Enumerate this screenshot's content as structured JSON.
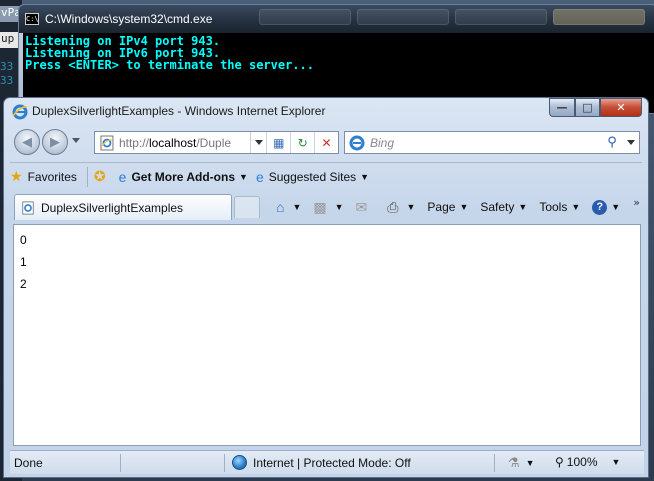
{
  "background_window": {
    "tab1": "vPa",
    "tab2": "up",
    "line_no_1": "33",
    "line_no_2": "33"
  },
  "cmd": {
    "title": "C:\\Windows\\system32\\cmd.exe",
    "icon_text": "C:\\",
    "lines": [
      "Listening on IPv4 port 943.",
      "Listening on IPv6 port 943.",
      "Press <ENTER> to terminate the server..."
    ]
  },
  "ie": {
    "title": "DuplexSilverlightExamples - Windows Internet Explorer",
    "window_controls": {
      "minimize": "—",
      "maximize": "□",
      "close": "✕"
    },
    "address": {
      "prefix": "http://",
      "host": "localhost",
      "path": "/Duple"
    },
    "search": {
      "placeholder": "Bing"
    },
    "favorites": {
      "favorites": "Favorites",
      "addons": "Get More Add-ons",
      "suggested": "Suggested Sites"
    },
    "tab": {
      "title": "DuplexSilverlightExamples"
    },
    "commands": {
      "page": "Page",
      "safety": "Safety",
      "tools": "Tools",
      "help": "?",
      "more": "»"
    },
    "content_lines": [
      "0",
      "1",
      "2"
    ],
    "status": {
      "text": "Done",
      "zone": "Internet | Protected Mode: Off",
      "zoom": "100%"
    }
  },
  "colors": {
    "console_text": "#00ffff",
    "console_bg": "#000000",
    "close_button": "#c8523a"
  }
}
